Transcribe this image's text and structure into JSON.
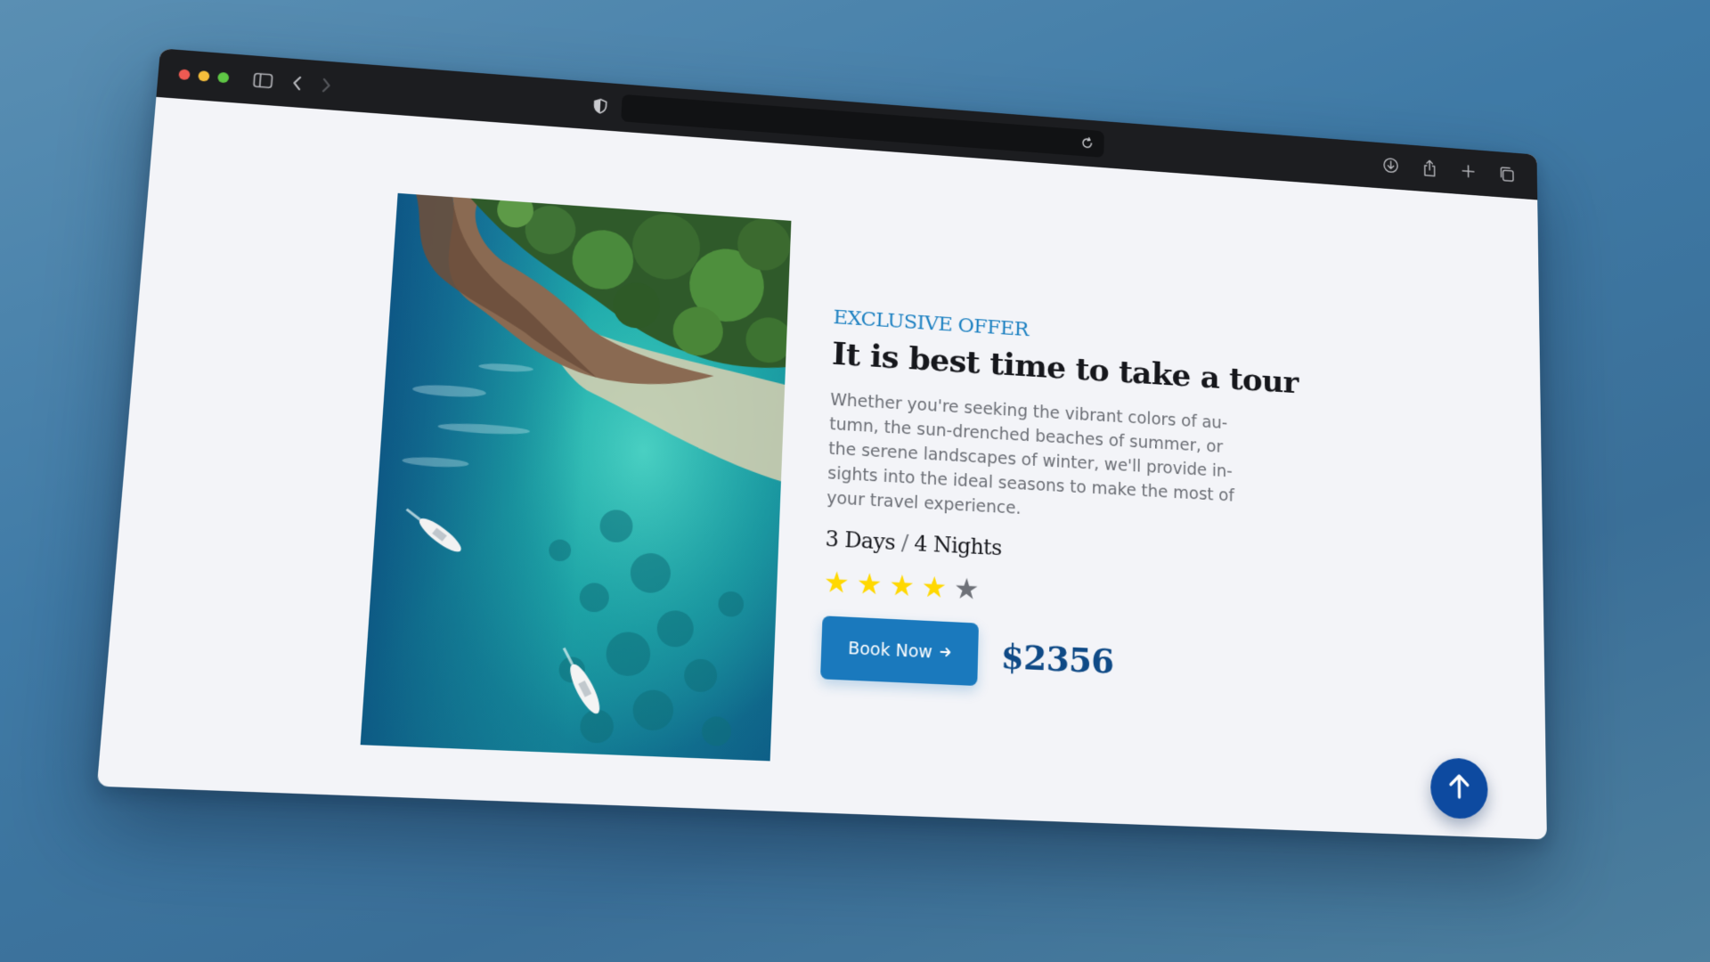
{
  "browser": {
    "toolbar_icons": {
      "sidebar": "sidebar-icon",
      "back": "chevron-left-icon",
      "forward": "chevron-right-icon",
      "shield": "shield-icon",
      "reload": "reload-icon",
      "download": "download-icon",
      "share": "share-icon",
      "new_tab": "plus-icon",
      "tabs": "tabs-overview-icon"
    }
  },
  "offer": {
    "eyebrow": "EXCLUSIVE OFFER",
    "title": "It is best time to take a tour",
    "description": "Whether you're seeking the vibrant colors of au-tumn, the sun-drenched beaches of summer, or the serene landscapes of winter, we'll provide in-sights into the ideal seasons to make the most of your travel experience.",
    "duration_days": "3 Days",
    "duration_separator": "/",
    "duration_nights": "4 Nights",
    "rating": 4,
    "rating_max": 5,
    "cta_label": "Book Now",
    "price": "$2356"
  },
  "colors": {
    "accent": "#1f82c2",
    "button": "#1a79bd",
    "price": "#0f4a86",
    "star_on": "#ffd800",
    "star_off": "#6e7178",
    "scroll_top": "#0d4aa0"
  },
  "image": {
    "subject": "aerial-view-coast-boats-icon"
  },
  "scroll_top_icon": "arrow-up-icon"
}
